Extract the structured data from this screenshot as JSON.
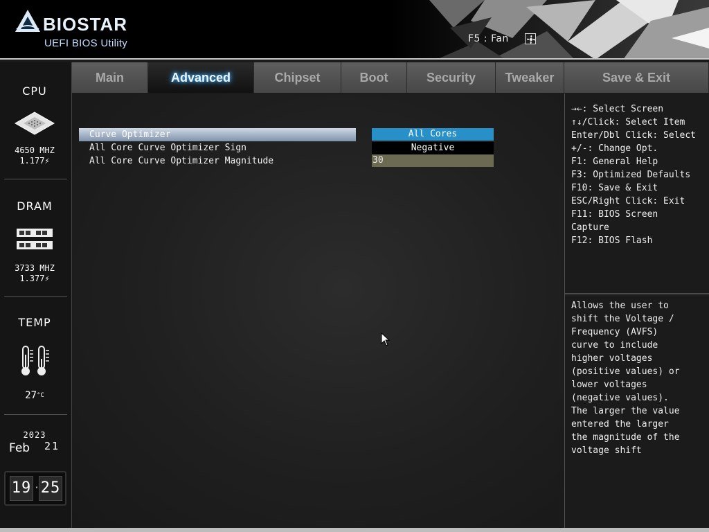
{
  "header": {
    "brand": "BIOSTAR",
    "subtitle": "UEFI BIOS Utility",
    "fan_hint": "F5 : Fan",
    "fan_icon": "fan-icon"
  },
  "sidebar": {
    "cpu": {
      "title": "CPU",
      "freq": "4650 MHZ",
      "volt": "1.177",
      "icon": "cpu-chip-icon"
    },
    "dram": {
      "title": "DRAM",
      "freq": "3733 MHZ",
      "volt": "1.377",
      "icon": "memory-module-icon"
    },
    "temp": {
      "title": "TEMP",
      "value": "27",
      "unit": "°C",
      "icon": "thermometer-icon"
    },
    "date": {
      "year": "2023",
      "month": "Feb",
      "day": "21"
    },
    "time": {
      "hours": "19",
      "minutes": "25"
    }
  },
  "tabs": [
    {
      "label": "Main",
      "active": false
    },
    {
      "label": "Advanced",
      "active": true
    },
    {
      "label": "Chipset",
      "active": false
    },
    {
      "label": "Boot",
      "active": false
    },
    {
      "label": "Security",
      "active": false
    },
    {
      "label": "Tweaker",
      "active": false
    },
    {
      "label": "Save & Exit",
      "active": false
    }
  ],
  "settings": [
    {
      "label": "Curve Optimizer",
      "value": "All Cores",
      "selected": true
    },
    {
      "label": "All Core Curve Optimizer Sign",
      "value": "Negative",
      "selected": false
    },
    {
      "label": "All Core Curve Optimizer Magnitude",
      "value": "30",
      "selected": false
    }
  ],
  "key_help": [
    "→←: Select Screen",
    "↑↓/Click: Select Item",
    "Enter/Dbl Click: Select",
    "+/-: Change Opt.",
    "F1: General Help",
    "F3: Optimized Defaults",
    "F10: Save & Exit",
    "ESC/Right Click: Exit",
    "F11: BIOS Screen",
    "Capture",
    "F12: BIOS Flash"
  ],
  "help_text": [
    "Allows the user to",
    "shift the Voltage /",
    "Frequency (AVFS)",
    "curve to include",
    "higher voltages",
    "(positive values) or",
    "lower voltages",
    "(negative values).",
    "The larger the value",
    "entered the larger",
    "the magnitude of the",
    "voltage shift"
  ],
  "colors": {
    "accent": "#2790c9",
    "selected_row": "#9aabbf",
    "magnitude_field": "#6c6a50"
  }
}
